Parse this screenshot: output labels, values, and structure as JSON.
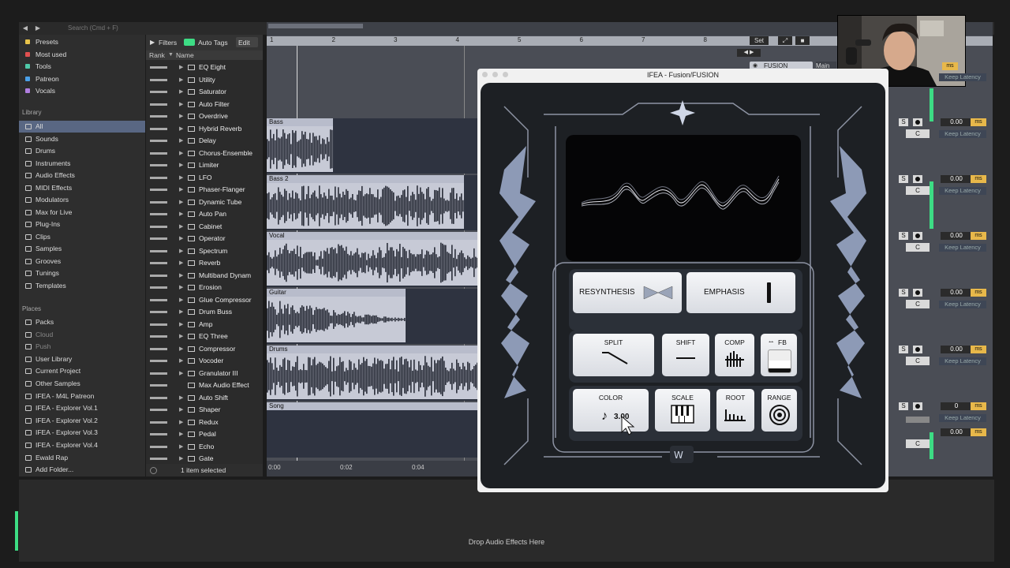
{
  "browser": {
    "search_placeholder": "Search (Cmd + F)",
    "collections": [
      {
        "label": "Presets",
        "color": "#e8c34a"
      },
      {
        "label": "Most used",
        "color": "#e05050"
      },
      {
        "label": "Tools",
        "color": "#4fc9a8"
      },
      {
        "label": "Patreon",
        "color": "#4aa0e8"
      },
      {
        "label": "Vocals",
        "color": "#b07ee0"
      }
    ],
    "library_heading": "Library",
    "library": [
      "All",
      "Sounds",
      "Drums",
      "Instruments",
      "Audio Effects",
      "MIDI Effects",
      "Modulators",
      "Max for Live",
      "Plug-Ins",
      "Clips",
      "Samples",
      "Grooves",
      "Tunings",
      "Templates"
    ],
    "places_heading": "Places",
    "places": [
      "Packs",
      "Cloud",
      "Push",
      "User Library",
      "Current Project",
      "Other Samples",
      "IFEA - M4L Patreon",
      "IFEA - Explorer Vol.1",
      "IFEA - Explorer Vol.2",
      "IFEA - Explorer Vol.3",
      "IFEA - Explorer Vol.4",
      "Ewald Rap",
      "Add Folder..."
    ]
  },
  "list": {
    "filters_label": "Filters",
    "autotags_label": "Auto Tags",
    "edit_label": "Edit",
    "col_rank": "Rank",
    "col_name": "Name",
    "items": [
      "EQ Eight",
      "Utility",
      "Saturator",
      "Auto Filter",
      "Overdrive",
      "Hybrid Reverb",
      "Delay",
      "Chorus-Ensemble",
      "Limiter",
      "LFO",
      "Phaser-Flanger",
      "Dynamic Tube",
      "Auto Pan",
      "Cabinet",
      "Operator",
      "Spectrum",
      "Reverb",
      "Multiband Dynam",
      "Erosion",
      "Glue Compressor",
      "Drum Buss",
      "Amp",
      "EQ Three",
      "Compressor",
      "Vocoder",
      "Granulator III",
      "Max Audio Effect",
      "Auto Shift",
      "Shaper",
      "Redux",
      "Pedal",
      "Echo",
      "Gate"
    ],
    "footer": "1 item selected"
  },
  "arrangement": {
    "bars": [
      "1",
      "2",
      "3",
      "4",
      "5",
      "6",
      "7",
      "8"
    ],
    "set_label": "Set",
    "tracks": [
      "Bass",
      "Bass 2",
      "Vocal",
      "Guitar",
      "Drums",
      "Song"
    ],
    "times": [
      "0:00",
      "0:02",
      "0:04"
    ],
    "rack_name": "FUSION",
    "main_label": "Main"
  },
  "mixer": {
    "volume": "0.00",
    "ms": "ms",
    "s_label": "S",
    "c_label": "C",
    "keep_latency": "Keep Latency",
    "last_volume": "0"
  },
  "plugin": {
    "window_title": "IFEA - Fusion/FUSION",
    "resynthesis": "RESYNTHESIS",
    "emphasis": "EMPHASIS",
    "split": "SPLIT",
    "shift": "SHIFT",
    "comp": "COMP",
    "fb": "FB",
    "color": "COLOR",
    "color_value": "3.00",
    "scale": "SCALE",
    "root": "ROOT",
    "range": "RANGE",
    "fb_level": 0.55
  },
  "bottom": {
    "drop_text": "Drop Audio Effects Here"
  },
  "colors": {
    "selection": "#596783",
    "accent": "#e8b84a",
    "meter": "#3ddc84"
  }
}
